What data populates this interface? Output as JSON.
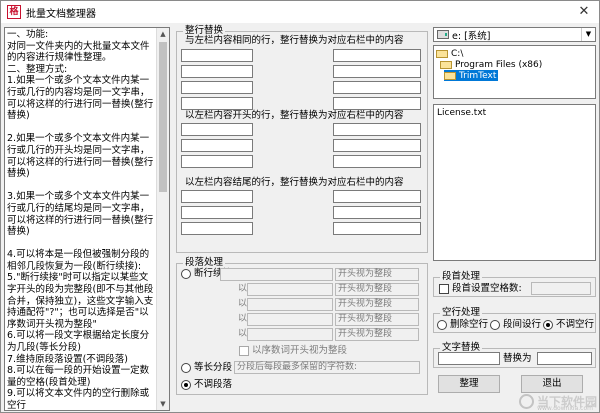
{
  "window": {
    "title": "批量文档整理器",
    "app_icon_text": "格",
    "close_glyph": "✕"
  },
  "help": {
    "text": "一、功能:\n对同一文件夹内的大批量文本文件的内容进行规律性整理。\n二、整理方式:\n1.如果一个或多个文本文件内某一行或几行的内容均是同一文字串，可以将这样的行进行同一替换(整行替换)\n\n2.如果一个或多个文本文件内某一行或几行的开头均是同一文字串，可以将这样的行进行同一替换(整行替换)\n\n3.如果一个或多个文本文件内某一行或几行的结尾均是同一文字串，可以将这样的行进行同一替换(整行替换)\n\n4.可以将本是一段但被强制分段的相邻几段恢复为一段(断行续接):\n5.\"断行续接\"时可以指定以某些文字开头的段为完整段(即不与其他段合并，保持独立)，这些文字输入支持通配符\"?\"；也可以选择是否\"以序数词开头视为整段\"\n6.可以将一段文字根据给定长度分为几段(等长分段)\n7.维持原段落设置(不调段落)\n8.可以在每一段的开始设置一定数量的空格(段首处理)\n9.可以将文本文件内的空行删除或空行"
  },
  "replace_group": {
    "title": "整行替换",
    "caption_same": "与左栏内容相同的行，整行替换为对应右栏中的内容",
    "caption_start": "以左栏内容开头的行，整行替换为对应右栏中的内容",
    "caption_end": "以左栏内容结尾的行，整行替换为对应右栏中的内容"
  },
  "paragraph_group": {
    "title": "段落处理",
    "radio_continue": "断行续接",
    "prefix_label": "以",
    "treat_as_para": "开头视为整段",
    "ordinal_check": "以序数词开头视为整段",
    "radio_equal": "等长分段",
    "equal_placeholder": "分段后每段最多保留的字符数:",
    "radio_none": "不调段落"
  },
  "drive": {
    "value": "e: [系统]"
  },
  "dirs": [
    "C:\\",
    "Program Files (x86)",
    "TrimText"
  ],
  "files": [
    "License.txt"
  ],
  "indent_group": {
    "title": "段首处理",
    "check_label": "段首设置空格数:"
  },
  "blank_group": {
    "title": "空行处理",
    "opt_delete": "删除空行",
    "opt_spacing": "段间设行",
    "opt_none": "不调空行"
  },
  "text_replace_group": {
    "title": "文字替换",
    "replace_with": "替换为"
  },
  "buttons": {
    "organize": "整理",
    "exit": "退出"
  },
  "watermark": {
    "brand": "当下软件园",
    "url": "www.downxia.com"
  }
}
